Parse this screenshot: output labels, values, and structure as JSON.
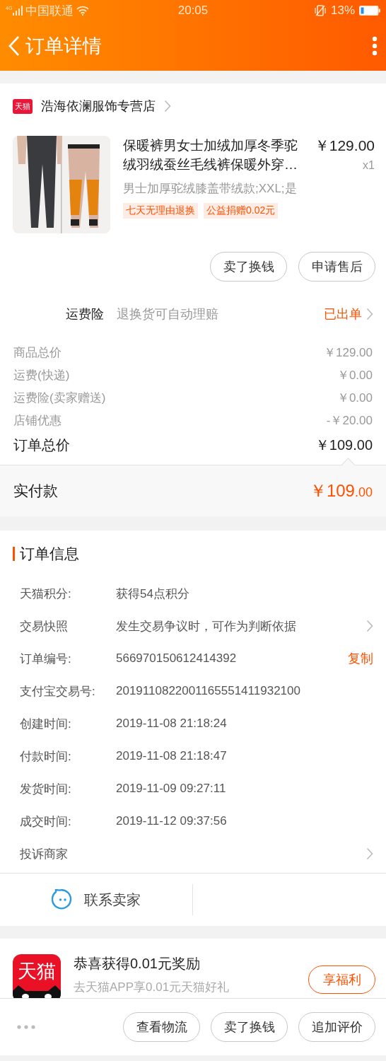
{
  "status_bar": {
    "network": "4G",
    "carrier": "中国联通",
    "time": "20:05",
    "battery": "13%"
  },
  "header": {
    "title": "订单详情"
  },
  "store": {
    "badge": "天猫",
    "name": "浩海依澜服饰专营店"
  },
  "product": {
    "title": "保暖裤男女士加绒加厚冬季驼绒羽绒蚕丝毛线裤保暖外穿…",
    "price": "￥129.00",
    "quantity": "x1",
    "sku": "男士加厚驼绒膝盖带绒款;XXL;是",
    "tags": [
      "七天无理由退换",
      "公益捐赠0.02元"
    ]
  },
  "item_actions": [
    "卖了换钱",
    "申请售后"
  ],
  "insurance": {
    "label": "运费险",
    "description": "退换货可自动理赔",
    "status": "已出单"
  },
  "fees": [
    {
      "label": "商品总价",
      "value": "￥129.00"
    },
    {
      "label": "运费(快递)",
      "value": "￥0.00"
    },
    {
      "label": "运费险(卖家赠送)",
      "value": "￥0.00"
    },
    {
      "label": "店铺优惠",
      "value": "-￥20.00"
    }
  ],
  "total": {
    "label": "订单总价",
    "value": "￥109.00"
  },
  "paid": {
    "label": "实付款",
    "amount": "￥109",
    "cents": ".00"
  },
  "order_info": {
    "title": "订单信息",
    "rows": [
      {
        "kind": "text",
        "label": "天猫积分:",
        "value": "获得54点积分"
      },
      {
        "kind": "link",
        "label": "交易快照",
        "value": "发生交易争议时，可作为判断依据"
      },
      {
        "kind": "copy",
        "label": "订单编号:",
        "value": "566970150612414392",
        "action": "复制"
      },
      {
        "kind": "text",
        "label": "支付宝交易号:",
        "value": "2019110822001165551411932100"
      },
      {
        "kind": "text",
        "label": "创建时间:",
        "value": "2019-11-08 21:18:24"
      },
      {
        "kind": "text",
        "label": "付款时间:",
        "value": "2019-11-08 21:18:47"
      },
      {
        "kind": "text",
        "label": "发货时间:",
        "value": "2019-11-09 09:27:11"
      },
      {
        "kind": "text",
        "label": "成交时间:",
        "value": "2019-11-12 09:37:56"
      },
      {
        "kind": "link",
        "label": "投诉商家"
      }
    ]
  },
  "contact": {
    "label": "联系卖家"
  },
  "promo": {
    "logo": "天猫",
    "title": "恭喜获得0.01元奖励",
    "subtitle": "去天猫APP享0.01元天猫好礼",
    "button": "享福利"
  },
  "bottom_bar": {
    "buttons": [
      "查看物流",
      "卖了换钱",
      "追加评价"
    ]
  }
}
